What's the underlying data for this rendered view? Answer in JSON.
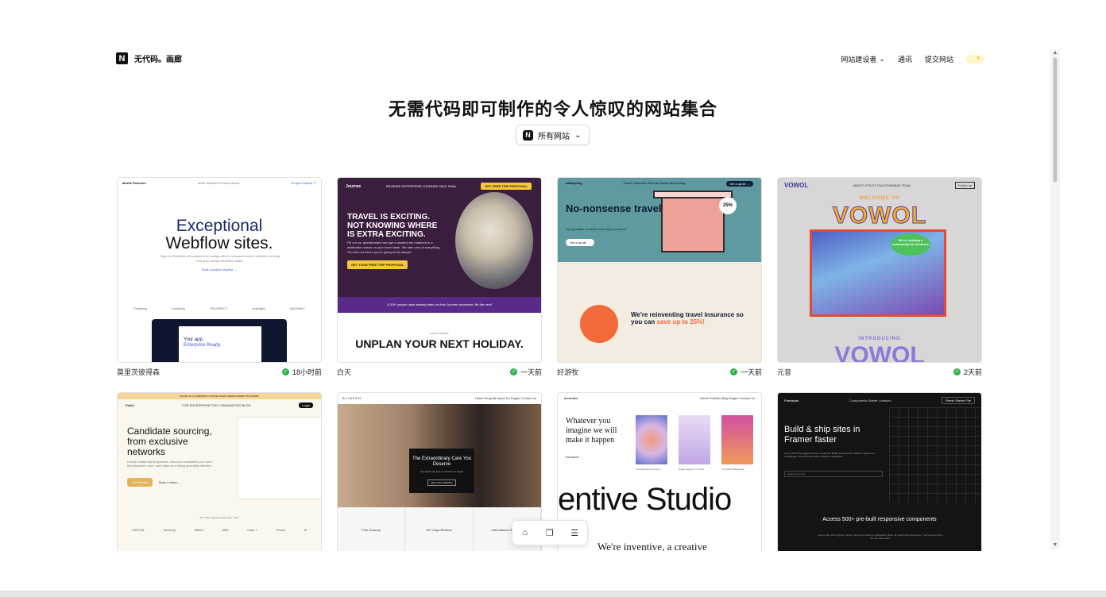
{
  "header": {
    "logo_text": "无代码。画廊",
    "logo_letter": "N",
    "nav": [
      {
        "label": "网站建设者"
      },
      {
        "label": "通讯"
      },
      {
        "label": "提交网站"
      }
    ]
  },
  "hero": {
    "title": "无需代码即可制作的令人惊叹的网站集合",
    "filter_label": "所有网站",
    "filter_icon_letter": "N"
  },
  "cards": [
    {
      "name": "莫里茨彼得森",
      "time": "18小时前",
      "thumb": {
        "brand": "Moritz Petersen",
        "nav": "Work  Services  Process  About",
        "cta_top": "Project request ↗",
        "h1": "Exceptional",
        "h2": "Webflow sites.",
        "sub": "High-end Webflow development for design-driven companies where attention to detail and pixel-perfect flexibility matter.",
        "link": "Start a project request →",
        "logos": [
          "Featuring",
          "Craftwork",
          "PROSPECT",
          "seedlight",
          "ANOMALY"
        ],
        "screen1": "Your app,",
        "screen2": "Enterprise Ready."
      }
    },
    {
      "name": "白天",
      "time": "一天前",
      "thumb": {
        "brand": "Journee",
        "nav": "REVIEWS  ENTERPRISE  JOURNEE PACK  FAQs",
        "cta": "GET FREE TRIP PROPOSAL",
        "head": "TRAVEL IS EXCITING. NOT KNOWING WHERE IS EXTRA EXCITING.",
        "para": "Fill out our questionnaire and get a mystery trip matched to a destination based on your travel taste. We take care of everything. You find out where you're going at the airport!",
        "btn": "GET YOUR FREE TRIP PROPOSAL",
        "band": "2,000+ people have already been on their Journee adventure. Be the next!",
        "how": "HOW IT WORKS",
        "big": "UNPLAN YOUR NEXT HOLIDAY."
      }
    },
    {
      "name": "好游牧",
      "time": "一天前",
      "thumb": {
        "brand": "safetywing",
        "nav": "Travel Insurance  Remote Health  About  Blog",
        "navbtn": "Get a quote →",
        "head": "No-nonsense travel insurance.",
        "para": "Say goodbye to hassle and high premiums.",
        "btn": "Get a quote →",
        "badge": "25%",
        "rein_a": "We're reinventing travel insurance so you can ",
        "rein_b": "save up to 25%!"
      }
    },
    {
      "name": "元音",
      "time": "2天前",
      "thumb": {
        "logo": "VOWOL",
        "nav": "ABOUT  UTILITY  FAQ  ROADMAP  TEAM",
        "follow": "Follow us",
        "welcome": "WELCOME TO",
        "title": "VOWOL",
        "bubble": "We're building a community for kindness",
        "intro": "INTRODUCING",
        "title2": "VOWOL"
      }
    },
    {
      "name": "",
      "thumb": {
        "strip": "PALLET IS A COMMUNITY-NATIVE TALENT RECRUITMENT PLATFORM",
        "brand": "Pallet",
        "nav": "FOR ENTERPRISE  FOR COMMUNITIES  BLOG",
        "btn_top": "Login",
        "head": "Candidate sourcing, from exclusive networks",
        "para": "Unlock vetted talent pipelines, discover candidates you won't find anywhere else, and make your hiring incredibly efficient.",
        "btn": "Get Started",
        "demo": "Book a demo →",
        "trusted": "Join 450+ startups using Pallet today",
        "logos": [
          "CAPITAL",
          "alchemy",
          "Wilbur",
          "stilla",
          "ramp ⚡",
          "Pesce",
          "III"
        ]
      }
    },
    {
      "name": "",
      "thumb": {
        "brand": "BLINKER",
        "nav": "Home  Shop All  About Us  Pages  Contact Us",
        "title": "The Extraordinary Care You Deserve",
        "sub": "The fresh new style you'll wear on repeat",
        "btn": "Shop The Collection",
        "features": [
          "Free Delivery",
          "30+ Days Returns",
          "International Shipping"
        ]
      }
    },
    {
      "name": "",
      "thumb": {
        "brand": "inventive",
        "nav": "Home  Portfolio  Blog  Pages  Contact Us",
        "serif": "Whatever you imagine we will make it happen",
        "intro": "Introduce →",
        "caps": [
          "The Morning Ceremony",
          "Sugar Hopper Fun Time",
          "The Secret Basement"
        ],
        "studio": "entive Studio",
        "lower": "We're inventive, a creative"
      }
    },
    {
      "name": "",
      "thumb": {
        "brand": "Framepad",
        "nav": "Components  Starter  Licenses",
        "navbtn": "Remix Starter File",
        "head": "Build & ship sites in Framer faster",
        "para": "Get a hold of the biggest Framer component library & framework. Made for speed and consistency. Thumb screws with a selection read-alone.",
        "input": "Enter your email",
        "signup": "Sign up",
        "acc": "Access 500+ pre-built responsive components",
        "small": "Get a hold of the biggest Framer component library & framework. Made for speed and consistency. You're never built a site like this before."
      }
    }
  ],
  "floating_toolbar": {
    "icons": [
      "home-icon",
      "gallery-icon",
      "filter-sliders-icon"
    ]
  },
  "colors": {
    "accent_green": "#2fb24c",
    "hero_text": "#111111"
  }
}
